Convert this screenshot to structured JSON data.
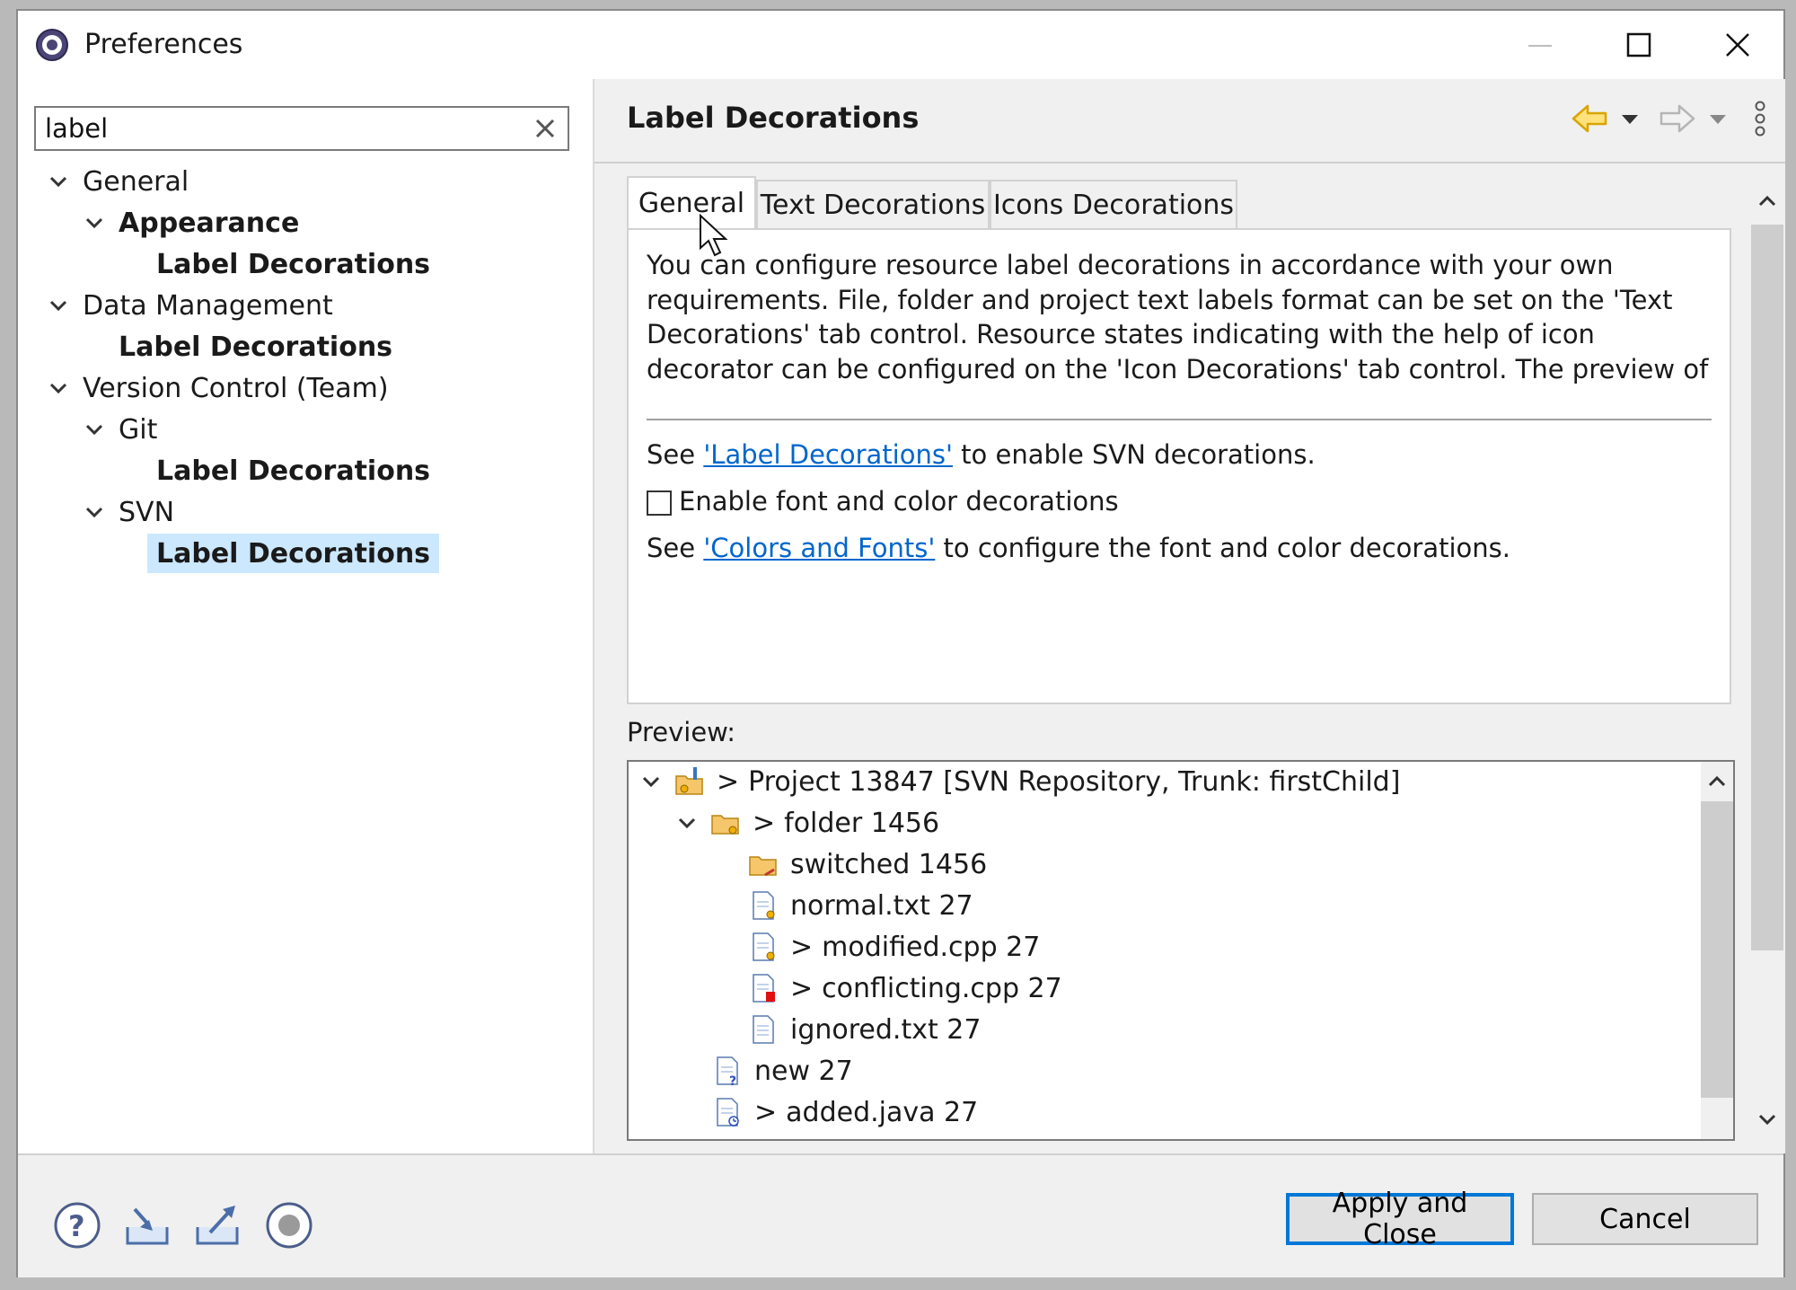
{
  "window": {
    "title": "Preferences"
  },
  "search": {
    "value": "label"
  },
  "tree": [
    {
      "label": "General",
      "bold": false
    },
    {
      "label": "Appearance",
      "bold": true
    },
    {
      "label": "Label Decorations",
      "bold": true
    },
    {
      "label": "Data Management",
      "bold": false
    },
    {
      "label": "Label Decorations",
      "bold": true
    },
    {
      "label": "Version Control (Team)",
      "bold": false
    },
    {
      "label": "Git",
      "bold": false
    },
    {
      "label": "Label Decorations",
      "bold": true
    },
    {
      "label": "SVN",
      "bold": false
    },
    {
      "label": "Label Decorations",
      "bold": true,
      "selected": true
    }
  ],
  "page": {
    "title": "Label Decorations",
    "tabs": [
      "General",
      "Text Decorations",
      "Icons Decorations"
    ],
    "active_tab": "General",
    "description": "You can configure resource label decorations in accordance with your own requirements. File, folder and project text labels format can be set on the 'Text Decorations' tab control. Resource states indicating with the help of icon decorator can be configured on the 'Icon Decorations' tab control. The preview of the resource",
    "see_label_prefix": "See ",
    "see_label_link": "'Label Decorations'",
    "see_label_suffix": " to enable SVN decorations.",
    "enable_checkbox_label": "Enable font and color decorations",
    "enable_checked": false,
    "see_colors_prefix": "See ",
    "see_colors_link": "'Colors and Fonts'",
    "see_colors_suffix": " to configure the font and color decorations.",
    "preview_label": "Preview:"
  },
  "preview": [
    {
      "prefix": ">",
      "label": "Project 13847 [SVN Repository, Trunk: firstChild]",
      "icon": "project-icon"
    },
    {
      "prefix": ">",
      "label": "folder 1456",
      "icon": "folder-icon"
    },
    {
      "prefix": "",
      "label": "switched 1456",
      "icon": "switched-folder-icon"
    },
    {
      "prefix": "",
      "label": "normal.txt 27",
      "icon": "file-icon"
    },
    {
      "prefix": ">",
      "label": "modified.cpp 27",
      "icon": "modified-file-icon"
    },
    {
      "prefix": ">",
      "label": "conflicting.cpp 27",
      "icon": "conflict-file-icon"
    },
    {
      "prefix": "",
      "label": "ignored.txt 27",
      "icon": "ignored-file-icon"
    },
    {
      "prefix": "",
      "label": "new 27",
      "icon": "new-file-icon"
    },
    {
      "prefix": ">",
      "label": "added.java 27",
      "icon": "added-file-icon"
    }
  ],
  "buttons": {
    "apply_close": "Apply and Close",
    "cancel": "Cancel"
  },
  "colors": {
    "selection": "#cce8ff",
    "link": "#0066cc",
    "accent": "#0078d7"
  }
}
